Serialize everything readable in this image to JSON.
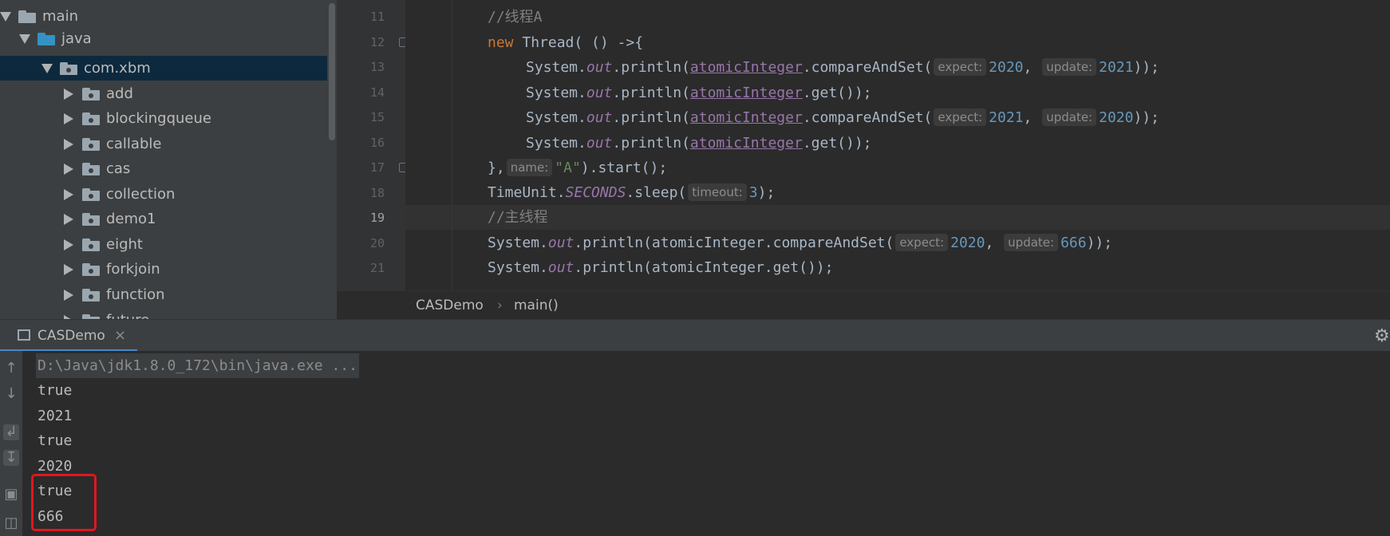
{
  "project_tree": {
    "items": [
      {
        "label": "main",
        "depth": 0,
        "expanded": true
      },
      {
        "label": "java",
        "depth": 1,
        "expanded": true
      },
      {
        "label": "com.xbm",
        "depth": 2,
        "expanded": true,
        "selected": true
      },
      {
        "label": "add",
        "depth": 3
      },
      {
        "label": "blockingqueue",
        "depth": 3
      },
      {
        "label": "callable",
        "depth": 3
      },
      {
        "label": "cas",
        "depth": 3
      },
      {
        "label": "collection",
        "depth": 3
      },
      {
        "label": "demo1",
        "depth": 3
      },
      {
        "label": "eight",
        "depth": 3
      },
      {
        "label": "forkjoin",
        "depth": 3
      },
      {
        "label": "function",
        "depth": 3
      },
      {
        "label": "future",
        "depth": 3
      }
    ]
  },
  "editor": {
    "line_numbers": [
      "11",
      "12",
      "13",
      "14",
      "15",
      "16",
      "17",
      "18",
      "19",
      "20",
      "21"
    ],
    "current_line": "19",
    "code": {
      "l11_comment": "//线程A",
      "l12_kw": "new",
      "l12_rest": " Thread( () ->{",
      "sysout": "System.",
      "out": "out",
      "println": ".println(",
      "atomic": "atomicInteger",
      "cas_call": ".compareAndSet(",
      "get_call": ".get());",
      "close_paren": "));",
      "comma": ",",
      "hint_expect": "expect:",
      "hint_update": "update:",
      "hint_name": "name:",
      "hint_timeout": "timeout:",
      "n2020": "2020",
      "n2021": "2021",
      "n666": "666",
      "n3": "3",
      "l17_start": "},",
      "l17_str": "\"A\"",
      "l17_end": ").start();",
      "timeunit": "TimeUnit.",
      "seconds": "SECONDS",
      "sleep": ".sleep(",
      "sleep_end": ");",
      "l19_comment": "//主线程",
      "l20_call": ".println(atomicInteger.compareAndSet(",
      "l21_call": ".println(atomicInteger.get());"
    }
  },
  "breadcrumb": {
    "class_name": "CASDemo",
    "separator": "›",
    "method": "main()"
  },
  "run_panel": {
    "tab_label": "CASDemo",
    "close_glyph": "×",
    "gear_glyph": "⚙",
    "command": "D:\\Java\\jdk1.8.0_172\\bin\\java.exe ...",
    "output": [
      "true",
      "2021",
      "true",
      "2020",
      "true",
      "666"
    ]
  },
  "colors": {
    "accent": "#4a88c7",
    "highlight_box": "#e0171f"
  },
  "icons": [
    "folder-icon",
    "package-icon",
    "expand-arrow-icon",
    "collapse-arrow-icon",
    "gear-icon",
    "close-icon",
    "up-arrow-icon",
    "down-arrow-icon",
    "soft-wrap-icon",
    "scroll-to-end-icon",
    "print-icon",
    "trash-icon"
  ]
}
